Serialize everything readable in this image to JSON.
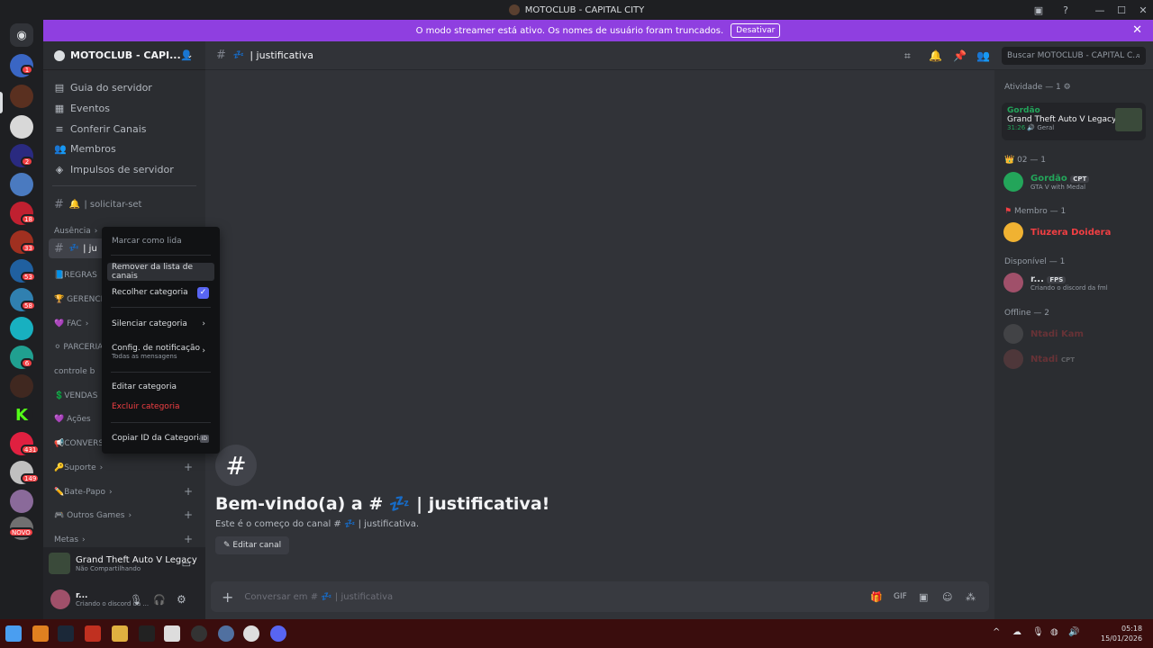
{
  "window": {
    "title": "MOTOCLUB - CAPITAL CITY"
  },
  "banner": {
    "text": "O modo streamer está ativo. Os nomes de usuário foram truncados.",
    "button": "Desativar"
  },
  "guild_badges": [
    "1",
    "2",
    "18",
    "33",
    "53",
    "58",
    "6",
    "431",
    "149",
    "NOVO"
  ],
  "server": {
    "name": "MOTOCLUB - CAPI...",
    "nav": [
      "Guia do servidor",
      "Eventos",
      "Conferir Canais",
      "Membros",
      "Impulsos de servidor"
    ],
    "channel_solicitar": "| solicitar-set",
    "category_ausencia": "Ausência",
    "active_channel": "| ju",
    "channels": [
      "📘REGRAS",
      "🏆 GERENCI",
      "💜 FAC",
      "⚪ PARCERIA",
      "controle b",
      "💲VENDAS",
      "💜 Ações",
      "📢CONVERS"
    ],
    "categories": [
      "🔑Suporte",
      "✏️Bate-Papo",
      "🎮 Outros Games",
      "Metas"
    ]
  },
  "game_panel": {
    "title": "Grand Theft Auto V Legacy",
    "sub": "Não Compartilhando"
  },
  "user_panel": {
    "name": "r...",
    "status": "Criando o discord da ..."
  },
  "channel": {
    "name": "| justificativa",
    "search_placeholder": "Buscar MOTOCLUB - CAPITAL C...",
    "welcome_title": "Bem-vindo(a) a # 💤 | justificativa!",
    "welcome_sub": "Este é o começo do canal # 💤 | justificativa.",
    "edit_button": "Editar canal",
    "composer_placeholder": "Conversar em # 💤 | justificativa"
  },
  "members": {
    "activity_header": "Atividade — 1",
    "activity": {
      "user": "Gordão",
      "game": "Grand Theft Auto V Legacy",
      "time": "31:26",
      "voice": "Geral"
    },
    "group_02": "02 — 1",
    "gordao": {
      "name": "Gordão",
      "tag": "CPT",
      "sub": "GTA V with Medal"
    },
    "group_membro": "Membro — 1",
    "tiuzera": {
      "name": "Tiuzera Doidera"
    },
    "group_disponivel": "Disponível — 1",
    "r_user": {
      "name": "r...",
      "tag": "FPS",
      "sub": "Criando o discord da fml"
    },
    "group_offline": "Offline — 2",
    "off1": {
      "name": "Ntadi Kam"
    },
    "off2": {
      "name": "Ntadi",
      "tag": "CPT"
    }
  },
  "context_menu": {
    "items": [
      "Marcar como lida",
      "Remover da lista de canais",
      "Recolher categoria",
      "Silenciar categoria",
      "Config. de notificação",
      "Editar categoria",
      "Excluir categoria",
      "Copiar ID da Categoria"
    ],
    "notif_sub": "Todas as mensagens",
    "id_badge": "ID"
  },
  "taskbar": {
    "time": "05:18",
    "date": "15/01/2026"
  },
  "colors": {
    "banner": "#8f3fe0",
    "danger": "#f23f43",
    "online": "#23a55a",
    "blurple": "#5865f2"
  }
}
